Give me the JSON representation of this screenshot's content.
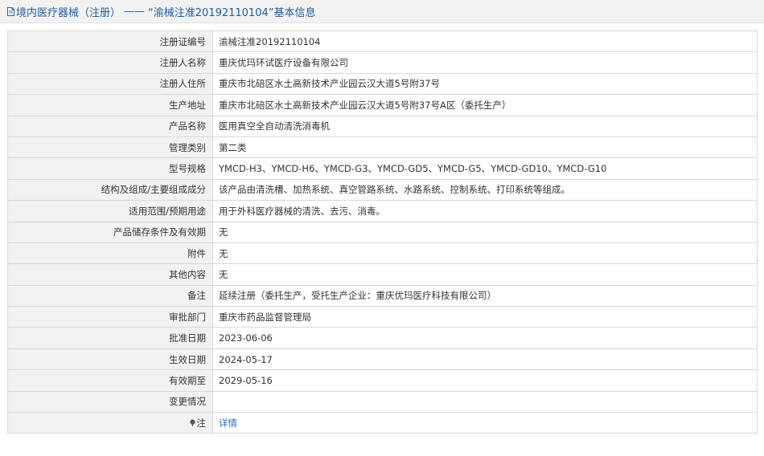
{
  "header": {
    "icon": "document-icon",
    "category": "境内医疗器械（注册）",
    "separator": "——",
    "title": "“渝械注准20192110104”基本信息"
  },
  "rows": [
    {
      "label": "注册证编号",
      "value": "渝械注准20192110104"
    },
    {
      "label": "注册人名称",
      "value": "重庆优玛环试医疗设备有限公司"
    },
    {
      "label": "注册人住所",
      "value": "重庆市北碚区水土高新技术产业园云汉大道5号附37号"
    },
    {
      "label": "生产地址",
      "value": "重庆市北碚区水土高新技术产业园云汉大道5号附37号A区（委托生产）"
    },
    {
      "label": "产品名称",
      "value": "医用真空全自动清洗消毒机"
    },
    {
      "label": "管理类别",
      "value": "第二类"
    },
    {
      "label": "型号规格",
      "value": "YMCD-H3、YMCD-H6、YMCD-G3、YMCD-GD5、YMCD-G5、YMCD-GD10、YMCD-G10"
    },
    {
      "label": "结构及组成/主要组成成分",
      "value": "该产品由清洗槽、加热系统、真空管路系统、水路系统、控制系统、打印系统等组成。"
    },
    {
      "label": "适用范围/预期用途",
      "value": "用于外科医疗器械的清洗、去污、消毒。"
    },
    {
      "label": "产品储存条件及有效期",
      "value": "无"
    },
    {
      "label": "附件",
      "value": "无"
    },
    {
      "label": "其他内容",
      "value": "无"
    },
    {
      "label": "备注",
      "value": "延续注册（委托生产，受托生产企业：重庆优玛医疗科技有限公司）"
    },
    {
      "label": "审批部门",
      "value": "重庆市药品监督管理局"
    },
    {
      "label": "批准日期",
      "value": "2023-06-06"
    },
    {
      "label": "生效日期",
      "value": "2024-05-17"
    },
    {
      "label": "有效期至",
      "value": "2029-05-16"
    },
    {
      "label": "变更情况",
      "value": ""
    }
  ],
  "note": {
    "icon": "pin-icon",
    "label": "注",
    "link_text": "详情"
  },
  "colors": {
    "header_text": "#1a5fa8",
    "link": "#1a6cc0",
    "label_bg": "#f2f2f2",
    "border": "#d9d9d9"
  }
}
